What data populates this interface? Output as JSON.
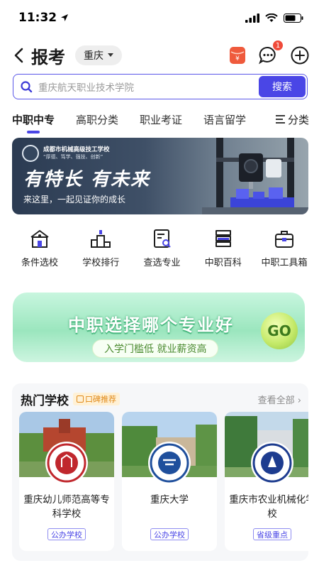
{
  "status_bar": {
    "time": "11:32"
  },
  "header": {
    "title": "报考",
    "city": "重庆",
    "chat_badge": "1"
  },
  "search": {
    "placeholder": "重庆航天职业技术学院",
    "button": "搜索"
  },
  "tabs": [
    {
      "label": "中职中专"
    },
    {
      "label": "高职分类"
    },
    {
      "label": "职业考证"
    },
    {
      "label": "语言留学"
    }
  ],
  "tab_more": "分类",
  "banner": {
    "school": "成都市机械高级技工学校",
    "motto": "“厚德、笃学、强技、创新”",
    "slogan": "有特长 有未来",
    "subtitle": "来这里，一起见证你的成长"
  },
  "quick_nav": [
    {
      "label": "条件选校",
      "icon": "school-building-icon"
    },
    {
      "label": "学校排行",
      "icon": "ranking-podium-icon"
    },
    {
      "label": "查选专业",
      "icon": "major-search-icon"
    },
    {
      "label": "中职百科",
      "icon": "encyclopedia-icon"
    },
    {
      "label": "中职工具箱",
      "icon": "toolbox-icon"
    }
  ],
  "promo": {
    "title": "中职选择哪个专业好",
    "subtitle": "入学门槛低 就业薪资高",
    "badge": "GO"
  },
  "hot_schools": {
    "title": "热门学校",
    "tag": "口碑推荐",
    "see_all": "查看全部",
    "schools": [
      {
        "name": "重庆幼儿师范高等专科学校",
        "type": "公办学校",
        "logo_color": "#c0272d"
      },
      {
        "name": "重庆大学",
        "type": "公办学校",
        "logo_color": "#1f4f9c"
      },
      {
        "name": "重庆市农业机械化学校",
        "type": "省级重点",
        "logo_color": "#1d3c8f"
      }
    ]
  },
  "colors": {
    "accent": "#4a46e6",
    "badge_red": "#f04b3a",
    "promo_green": "#9be6be"
  }
}
